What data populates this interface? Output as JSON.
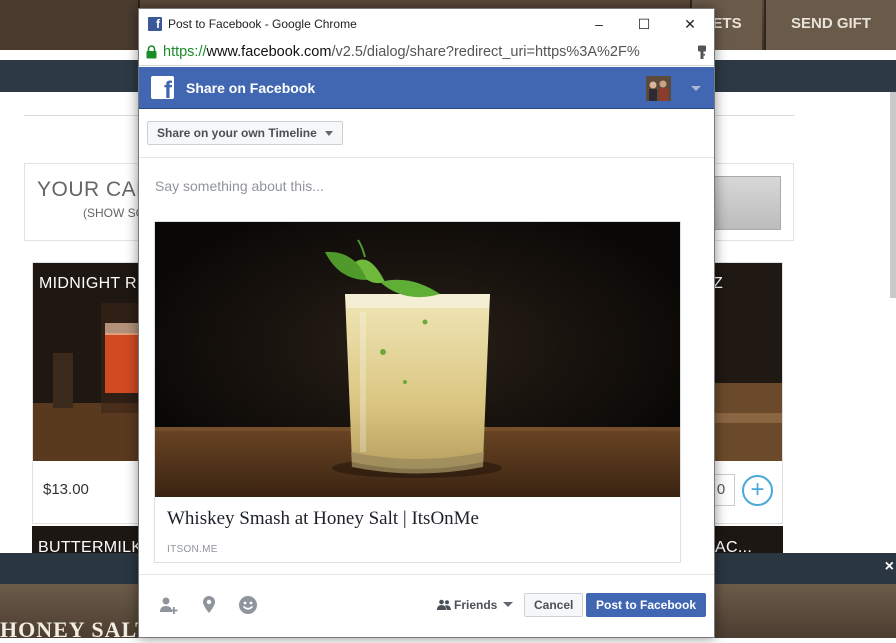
{
  "background": {
    "nav_items": [
      "ETS",
      "SEND GIFT"
    ],
    "cart_title": "YOUR CAR",
    "cart_subtitle": "(SHOW SO",
    "cards": [
      {
        "title": "MIDNIGHT R",
        "price": "$13.00"
      },
      {
        "title": "Z",
        "qty": "0"
      },
      {
        "title": "BUTTERMILK"
      },
      {
        "title": "AC..."
      }
    ],
    "footer_text": "HONEY SALT ME",
    "close_label": "×"
  },
  "window": {
    "title": "Post to Facebook - Google Chrome",
    "favicon": "f",
    "minimize": "–",
    "maximize": "☐",
    "close": "✕",
    "url_scheme": "https://",
    "url_domain": "www.facebook.com",
    "url_path": "/v2.5/dialog/share?redirect_uri=https%3A%2F%"
  },
  "dialog": {
    "header_title": "Share on Facebook",
    "logo": "f",
    "timeline_select": "Share on your own Timeline",
    "message_placeholder": "Say something about this...",
    "link_title": "Whiskey Smash at Honey Salt | ItsOnMe",
    "link_domain": "ITSON.ME",
    "audience": "Friends",
    "cancel_label": "Cancel",
    "post_label": "Post to Facebook"
  },
  "colors": {
    "facebook_blue": "#4267b2",
    "url_green": "#1a8c27",
    "accent_plus": "#4aa9d9"
  },
  "icons": [
    "fb-favicon",
    "lock-icon",
    "key-icon",
    "tag-friends-icon",
    "location-pin-icon",
    "feeling-smiley-icon",
    "friends-audience-icon"
  ]
}
